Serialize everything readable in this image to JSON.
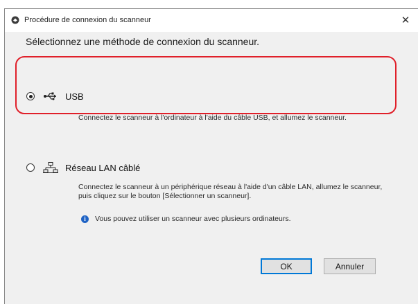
{
  "window": {
    "title": "Procédure de connexion du scanneur",
    "close_label": "✕"
  },
  "heading": "Sélectionnez une méthode de connexion du scanneur.",
  "options": [
    {
      "label": "USB",
      "selected": true,
      "icon": "usb-icon",
      "description": "Connectez le scanneur à l'ordinateur à l'aide du câble USB, et allumez le scanneur."
    },
    {
      "label": "Réseau LAN câblé",
      "selected": false,
      "icon": "network-icon",
      "description": "Connectez le scanneur à un périphérique réseau à l'aide d'un câble LAN, allumez le scanneur, puis cliquez sur le bouton [Sélectionner un scanneur]."
    }
  ],
  "info": {
    "icon": "info-icon",
    "text": "Vous pouvez utiliser un scanneur avec plusieurs ordinateurs."
  },
  "buttons": {
    "ok": "OK",
    "cancel": "Annuler"
  },
  "colors": {
    "highlight": "#e0202a",
    "info_icon": "#1e62c4",
    "default_button_border": "#0078d7"
  }
}
